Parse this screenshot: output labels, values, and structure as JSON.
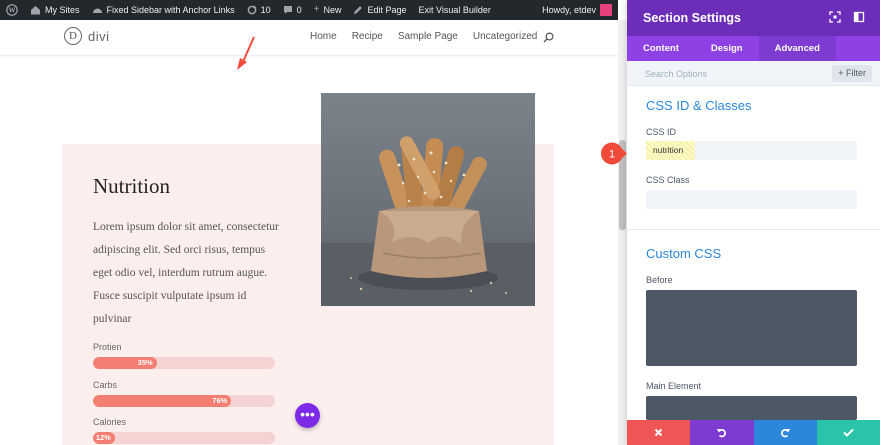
{
  "adminbar": {
    "my_sites": "My Sites",
    "site_name": "Fixed Sidebar with Anchor Links",
    "updates_count": "10",
    "comments_count": "0",
    "new_label": "New",
    "edit_page": "Edit Page",
    "exit_builder": "Exit Visual Builder",
    "howdy": "Howdy, etdev"
  },
  "header": {
    "logo_letter": "D",
    "logo_text": "divi",
    "nav": [
      "Home",
      "Recipe",
      "Sample Page",
      "Uncategorized"
    ]
  },
  "content": {
    "heading": "Nutrition",
    "paragraph": "Lorem ipsum dolor sit amet, consectetur adipiscing elit. Sed orci risus, tempus eget odio vel, interdum rutrum augue. Fusce suscipit vulputate ipsum id pulvinar",
    "bars": [
      {
        "label": "Protien",
        "percent": 35,
        "text": "35%"
      },
      {
        "label": "Carbs",
        "percent": 76,
        "text": "76%"
      },
      {
        "label": "Calories",
        "percent": 12,
        "text": "12%"
      }
    ],
    "bar_color": "#f37f72",
    "bar_track_color": "#f3d4d3",
    "dots_label": "•••"
  },
  "panel": {
    "title": "Section Settings",
    "tabs": [
      "Content",
      "Design",
      "Advanced"
    ],
    "active_tab": "Advanced",
    "search_placeholder": "Search Options",
    "filter_label": "Filter",
    "css_section_title": "CSS ID & Classes",
    "css_id_label": "CSS ID",
    "css_id_value": "nutrition",
    "css_class_label": "CSS Class",
    "custom_css_title": "Custom CSS",
    "before_label": "Before",
    "main_element_label": "Main Element",
    "step_number": "1",
    "accent_color": "#6c2eb9",
    "footer_colors": [
      "#ef5555",
      "#7d3bd1",
      "#2b87da",
      "#29c4a9"
    ]
  }
}
